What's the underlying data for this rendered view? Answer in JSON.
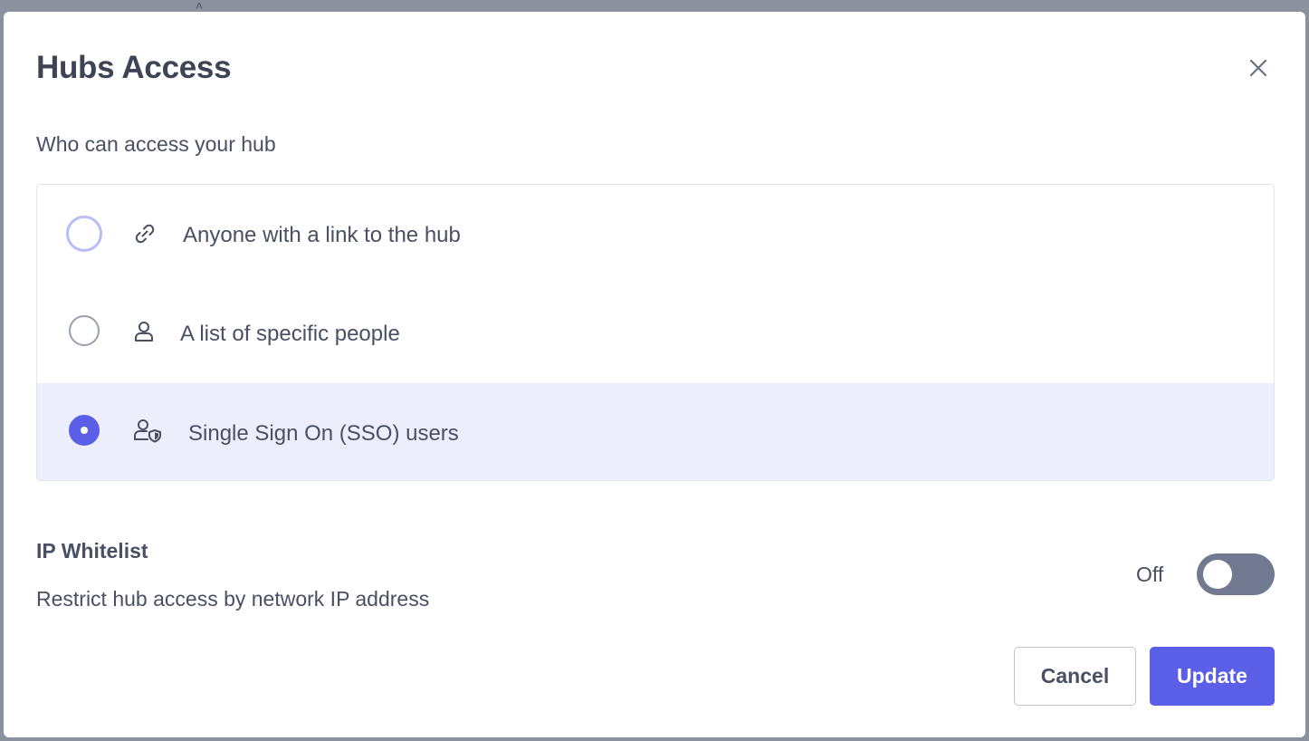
{
  "modal": {
    "title": "Hubs Access",
    "close_icon": "close-icon"
  },
  "access": {
    "heading": "Who can access your hub",
    "options": [
      {
        "label": "Anyone with a link to the hub",
        "icon": "link-icon",
        "selected": false
      },
      {
        "label": "A list of specific people",
        "icon": "user-icon",
        "selected": false
      },
      {
        "label": "Single Sign On (SSO) users",
        "icon": "user-shield-icon",
        "selected": true
      }
    ]
  },
  "ip_whitelist": {
    "title": "IP Whitelist",
    "description": "Restrict hub access by network IP address",
    "toggle_state_label": "Off",
    "enabled": false
  },
  "footer": {
    "cancel_label": "Cancel",
    "update_label": "Update"
  },
  "colors": {
    "accent": "#5b5fe8",
    "selected_row": "#eceefb",
    "toggle_off": "#727a91",
    "text": "#4a5063"
  }
}
